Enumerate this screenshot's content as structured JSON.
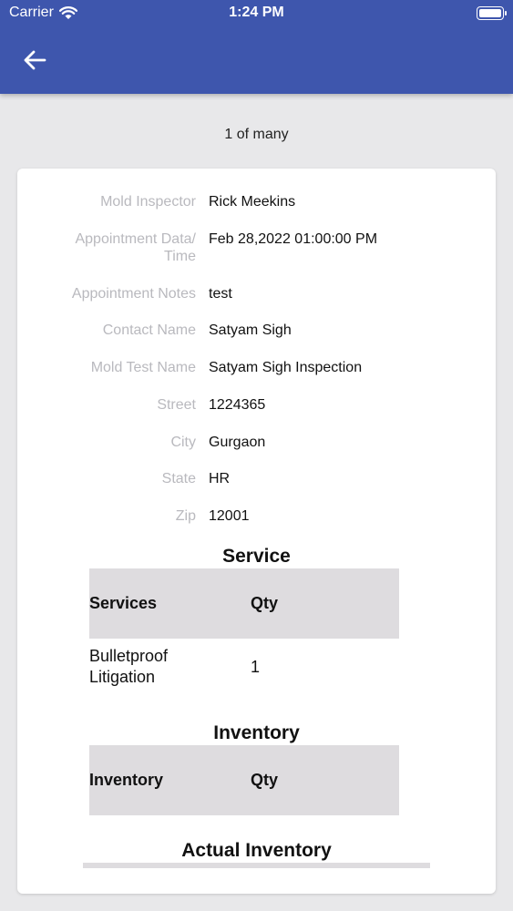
{
  "status_bar": {
    "carrier": "Carrier",
    "time": "1:24 PM"
  },
  "pager": "1 of many",
  "details": [
    {
      "label": "Mold Inspector",
      "value": "Rick Meekins"
    },
    {
      "label": "Appointment Data/ Time",
      "value": "Feb 28,2022 01:00:00 PM"
    },
    {
      "label": "Appointment Notes",
      "value": "test"
    },
    {
      "label": "Contact Name",
      "value": "Satyam Sigh"
    },
    {
      "label": "Mold Test Name",
      "value": "Satyam Sigh Inspection"
    },
    {
      "label": "Street",
      "value": "1224365"
    },
    {
      "label": "City",
      "value": "Gurgaon"
    },
    {
      "label": "State",
      "value": "HR"
    },
    {
      "label": "Zip",
      "value": "12001"
    }
  ],
  "service": {
    "title": "Service",
    "columns": [
      "Services",
      "Qty"
    ],
    "rows": [
      {
        "name": "Bulletproof Litigation",
        "qty": "1"
      }
    ]
  },
  "inventory": {
    "title": "Inventory",
    "columns": [
      "Inventory",
      "Qty"
    ]
  },
  "actual_inventory": {
    "title": "Actual Inventory"
  }
}
